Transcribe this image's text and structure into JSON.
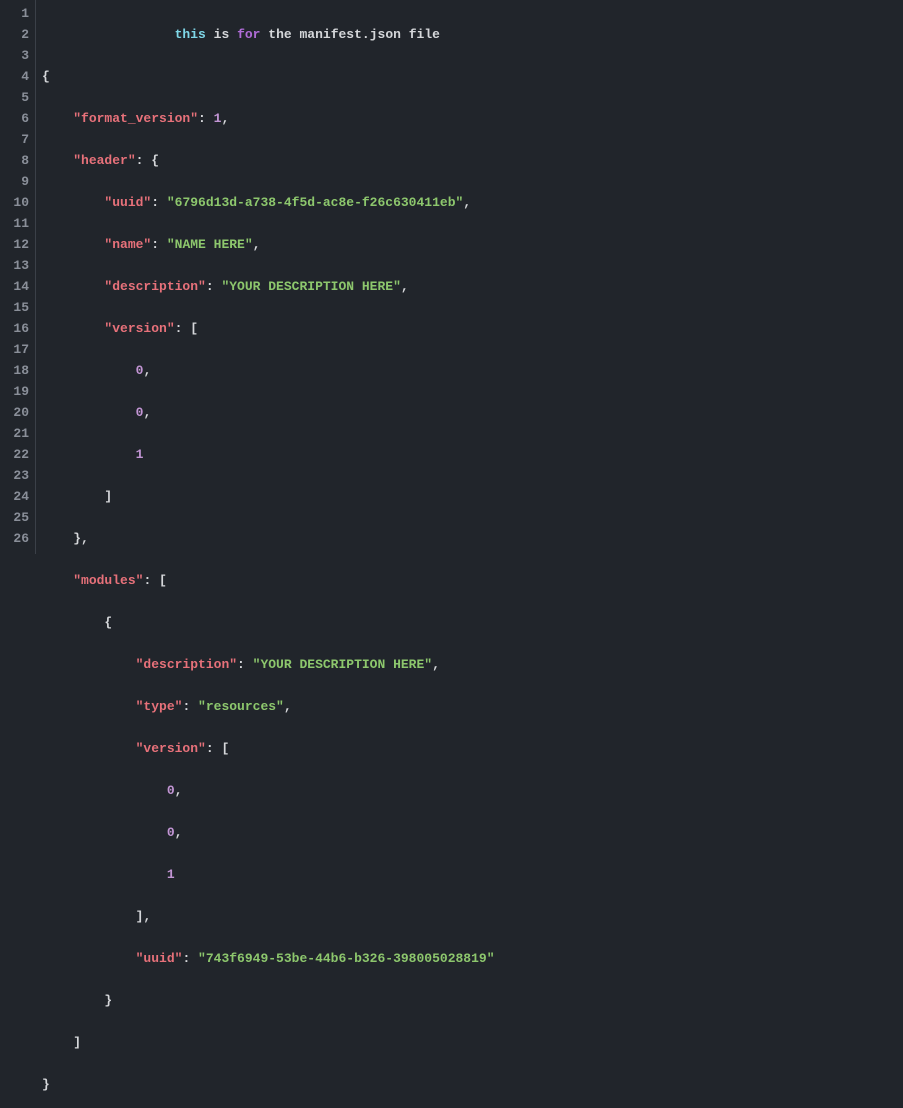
{
  "lineCount": 26,
  "code": {
    "line1": {
      "this": "this",
      "is": "is",
      "for": "for",
      "rest": "the manifest.json file"
    },
    "format_version_key": "\"format_version\"",
    "format_version_val": "1",
    "header_key": "\"header\"",
    "uuid_key": "\"uuid\"",
    "header_uuid_val": "\"6796d13d-a738-4f5d-ac8e-f26c630411eb\"",
    "name_key": "\"name\"",
    "name_val": "\"NAME HERE\"",
    "description_key": "\"description\"",
    "header_desc_val": "\"YOUR DESCRIPTION HERE\"",
    "version_key": "\"version\"",
    "v0": "0",
    "v1": "1",
    "modules_key": "\"modules\"",
    "modules_desc_val": "\"YOUR DESCRIPTION HERE\"",
    "type_key": "\"type\"",
    "type_val": "\"resources\"",
    "modules_uuid_val": "\"743f6949-53be-44b6-b326-398005028819\""
  },
  "colors": {
    "background": "#21252b",
    "keyword": "#b06cd8",
    "string": "#8dc76d",
    "key": "#e7717a",
    "number": "#c295d4",
    "this": "#7fd7e8"
  }
}
